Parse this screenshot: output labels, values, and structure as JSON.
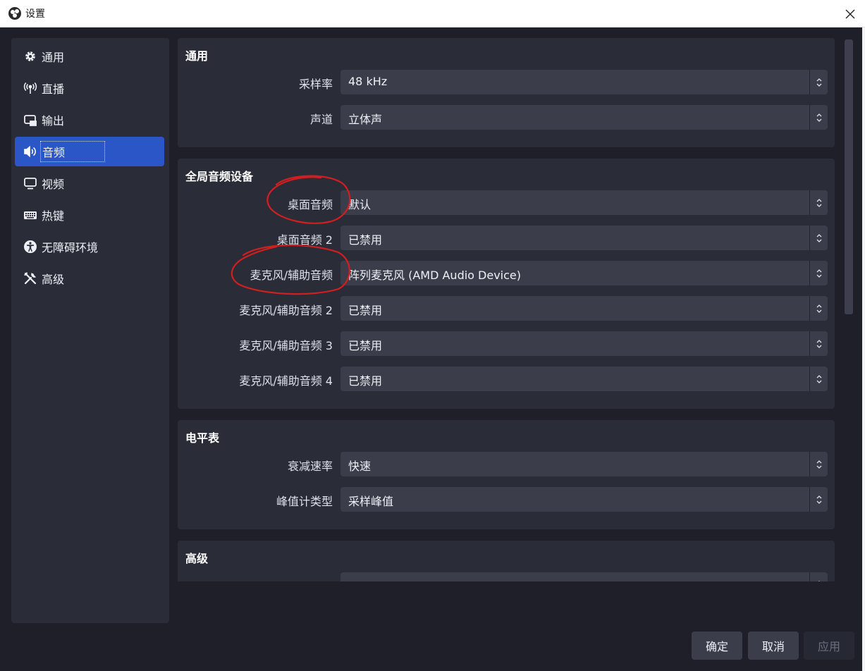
{
  "window": {
    "title": "设置",
    "close_icon": "close-icon"
  },
  "sidebar": {
    "items": [
      {
        "label": "通用",
        "icon": "gear-icon"
      },
      {
        "label": "直播",
        "icon": "antenna-icon"
      },
      {
        "label": "输出",
        "icon": "output-icon"
      },
      {
        "label": "音频",
        "icon": "speaker-icon",
        "active": true
      },
      {
        "label": "视频",
        "icon": "monitor-icon"
      },
      {
        "label": "热键",
        "icon": "keyboard-icon"
      },
      {
        "label": "无障碍环境",
        "icon": "accessibility-icon"
      },
      {
        "label": "高级",
        "icon": "tools-icon"
      }
    ]
  },
  "sections": {
    "general": {
      "title": "通用",
      "rows": [
        {
          "label": "采样率",
          "value": "48 kHz"
        },
        {
          "label": "声道",
          "value": "立体声"
        }
      ]
    },
    "global_audio": {
      "title": "全局音频设备",
      "rows": [
        {
          "label": "桌面音频",
          "value": "默认"
        },
        {
          "label": "桌面音频 2",
          "value": "已禁用"
        },
        {
          "label": "麦克风/辅助音频",
          "value": "阵列麦克风 (AMD Audio Device)"
        },
        {
          "label": "麦克风/辅助音频 2",
          "value": "已禁用"
        },
        {
          "label": "麦克风/辅助音频 3",
          "value": "已禁用"
        },
        {
          "label": "麦克风/辅助音频 4",
          "value": "已禁用"
        }
      ]
    },
    "meters": {
      "title": "电平表",
      "rows": [
        {
          "label": "衰减速率",
          "value": "快速"
        },
        {
          "label": "峰值计类型",
          "value": "采样峰值"
        }
      ]
    },
    "advanced": {
      "title": "高级",
      "rows": [
        {
          "label": "",
          "value": ""
        }
      ]
    }
  },
  "buttons": {
    "ok": "确定",
    "cancel": "取消",
    "apply": "应用"
  },
  "colors": {
    "accent": "#2b56c7",
    "annotation": "#d11f1f"
  }
}
